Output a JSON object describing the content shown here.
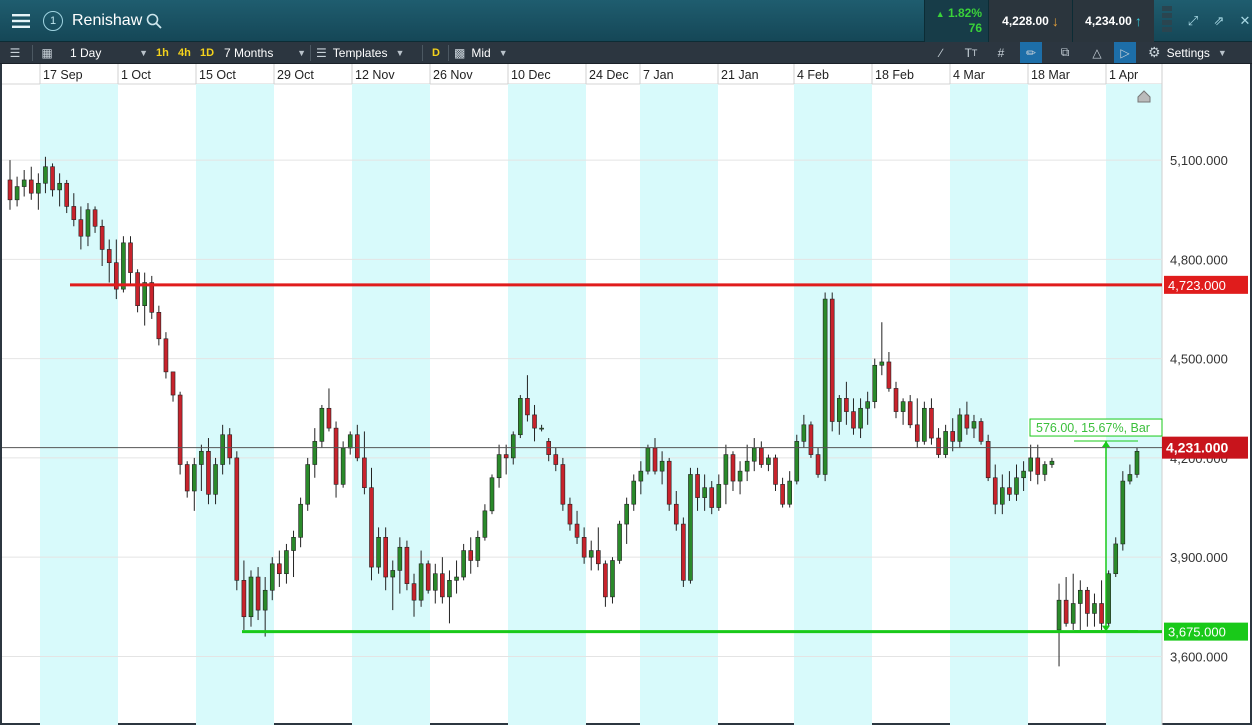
{
  "header": {
    "instrument": "Renishaw",
    "account_number": "1",
    "change_percent": "1.82%",
    "change_points": "76",
    "sell_price": "4,228.00",
    "buy_price": "4,234.00"
  },
  "toolbar": {
    "interval": "1 Day",
    "quick_intervals": [
      "1h",
      "4h",
      "1D"
    ],
    "range": "7 Months",
    "templates": "Templates",
    "d_badge": "D",
    "price_type": "Mid",
    "settings": "Settings"
  },
  "icons": {
    "menu": "hamburger-icon",
    "account": "account-number-icon",
    "search": "search-icon",
    "down_arrow": "arrow-down-icon",
    "up_arrow": "arrow-up-icon",
    "expand": "expand-icon",
    "popout": "popout-icon",
    "close": "close-icon"
  },
  "colors": {
    "up_candle": "#2a8a2a",
    "down_candle": "#c8232c",
    "resistance": "#e01c1c",
    "support": "#19c919",
    "shade": "#d8fafb",
    "price_tag": "#c8141c"
  },
  "chart_data": {
    "type": "candlestick",
    "date_labels": [
      "17 Sep",
      "1 Oct",
      "15 Oct",
      "29 Oct",
      "12 Nov",
      "26 Nov",
      "10 Dec",
      "24 Dec",
      "7 Jan",
      "21 Jan",
      "4 Feb",
      "18 Feb",
      "4 Mar",
      "18 Mar",
      "1 Apr"
    ],
    "y_ticks": [
      3600,
      3900,
      4200,
      4500,
      4800,
      5100
    ],
    "y_tick_labels": [
      "3,600.000",
      "3,900.000",
      "4,200.000",
      "4,500.000",
      "4,800.000",
      "5,100.000"
    ],
    "ylim": [
      3420,
      5330
    ],
    "resistance_label": "4,723.000",
    "resistance": 4723,
    "support_label": "3,675.000",
    "support": 3675,
    "current_label": "4,231.000",
    "current": 4231,
    "measure_label": "576.00, 15.67%, Bar",
    "measure_from": 3675,
    "measure_to": 4251,
    "candles": [
      [
        5040,
        5100,
        4950,
        4980
      ],
      [
        4980,
        5050,
        4960,
        5020
      ],
      [
        5020,
        5070,
        4990,
        5040
      ],
      [
        5040,
        5080,
        4980,
        5000
      ],
      [
        5000,
        5060,
        4950,
        5030
      ],
      [
        5030,
        5110,
        5000,
        5080
      ],
      [
        5080,
        5090,
        4990,
        5010
      ],
      [
        5010,
        5060,
        4960,
        5030
      ],
      [
        5030,
        5040,
        4940,
        4960
      ],
      [
        4960,
        5000,
        4900,
        4920
      ],
      [
        4920,
        4960,
        4830,
        4870
      ],
      [
        4870,
        4970,
        4840,
        4950
      ],
      [
        4950,
        4960,
        4880,
        4900
      ],
      [
        4900,
        4920,
        4780,
        4830
      ],
      [
        4830,
        4860,
        4730,
        4790
      ],
      [
        4790,
        4860,
        4680,
        4710
      ],
      [
        4710,
        4870,
        4700,
        4850
      ],
      [
        4850,
        4870,
        4720,
        4760
      ],
      [
        4760,
        4770,
        4640,
        4660
      ],
      [
        4660,
        4760,
        4600,
        4730
      ],
      [
        4730,
        4750,
        4620,
        4640
      ],
      [
        4640,
        4660,
        4540,
        4560
      ],
      [
        4560,
        4580,
        4440,
        4460
      ],
      [
        4460,
        4460,
        4370,
        4390
      ],
      [
        4390,
        4400,
        4150,
        4180
      ],
      [
        4180,
        4190,
        4080,
        4100
      ],
      [
        4100,
        4200,
        4040,
        4180
      ],
      [
        4180,
        4240,
        4100,
        4220
      ],
      [
        4220,
        4260,
        4060,
        4090
      ],
      [
        4090,
        4200,
        4060,
        4180
      ],
      [
        4180,
        4300,
        4150,
        4270
      ],
      [
        4270,
        4290,
        4180,
        4200
      ],
      [
        4200,
        4220,
        3800,
        3830
      ],
      [
        3830,
        3890,
        3680,
        3720
      ],
      [
        3720,
        3860,
        3690,
        3840
      ],
      [
        3840,
        3870,
        3710,
        3740
      ],
      [
        3740,
        3840,
        3660,
        3800
      ],
      [
        3800,
        3900,
        3770,
        3880
      ],
      [
        3880,
        3920,
        3810,
        3850
      ],
      [
        3850,
        3940,
        3820,
        3920
      ],
      [
        3920,
        3980,
        3840,
        3960
      ],
      [
        3960,
        4080,
        3930,
        4060
      ],
      [
        4060,
        4200,
        4040,
        4180
      ],
      [
        4180,
        4290,
        4140,
        4250
      ],
      [
        4250,
        4360,
        4230,
        4350
      ],
      [
        4350,
        4410,
        4280,
        4290
      ],
      [
        4290,
        4310,
        4080,
        4120
      ],
      [
        4120,
        4250,
        4110,
        4230
      ],
      [
        4230,
        4280,
        4210,
        4270
      ],
      [
        4270,
        4300,
        4190,
        4200
      ],
      [
        4200,
        4280,
        4090,
        4110
      ],
      [
        4110,
        4170,
        3830,
        3870
      ],
      [
        3870,
        3990,
        3850,
        3960
      ],
      [
        3960,
        3990,
        3800,
        3840
      ],
      [
        3840,
        3890,
        3740,
        3860
      ],
      [
        3860,
        3960,
        3790,
        3930
      ],
      [
        3930,
        3950,
        3800,
        3820
      ],
      [
        3820,
        3850,
        3720,
        3770
      ],
      [
        3770,
        3920,
        3750,
        3880
      ],
      [
        3880,
        3890,
        3790,
        3800
      ],
      [
        3800,
        3880,
        3760,
        3850
      ],
      [
        3850,
        3900,
        3760,
        3780
      ],
      [
        3780,
        3860,
        3700,
        3830
      ],
      [
        3830,
        3890,
        3790,
        3840
      ],
      [
        3840,
        3940,
        3830,
        3920
      ],
      [
        3920,
        3960,
        3850,
        3890
      ],
      [
        3890,
        3980,
        3870,
        3960
      ],
      [
        3960,
        4060,
        3950,
        4040
      ],
      [
        4040,
        4150,
        4030,
        4140
      ],
      [
        4140,
        4240,
        4110,
        4210
      ],
      [
        4210,
        4240,
        4150,
        4200
      ],
      [
        4200,
        4280,
        4180,
        4270
      ],
      [
        4270,
        4390,
        4260,
        4380
      ],
      [
        4380,
        4450,
        4310,
        4330
      ],
      [
        4330,
        4360,
        4250,
        4290
      ],
      [
        4290,
        4300,
        4280,
        4290
      ],
      [
        4250,
        4260,
        4190,
        4210
      ],
      [
        4210,
        4230,
        4160,
        4180
      ],
      [
        4180,
        4200,
        4040,
        4060
      ],
      [
        4060,
        4080,
        3980,
        4000
      ],
      [
        4000,
        4040,
        3940,
        3960
      ],
      [
        3960,
        3990,
        3880,
        3900
      ],
      [
        3900,
        3950,
        3860,
        3920
      ],
      [
        3920,
        3990,
        3860,
        3880
      ],
      [
        3880,
        3890,
        3750,
        3780
      ],
      [
        3780,
        3900,
        3760,
        3890
      ],
      [
        3890,
        4010,
        3880,
        4000
      ],
      [
        4000,
        4080,
        3940,
        4060
      ],
      [
        4060,
        4150,
        4040,
        4130
      ],
      [
        4130,
        4190,
        4090,
        4160
      ],
      [
        4160,
        4240,
        4150,
        4230
      ],
      [
        4230,
        4260,
        4150,
        4160
      ],
      [
        4160,
        4220,
        4120,
        4190
      ],
      [
        4190,
        4200,
        4040,
        4060
      ],
      [
        4060,
        4100,
        3980,
        4000
      ],
      [
        4000,
        4020,
        3810,
        3830
      ],
      [
        3830,
        4170,
        3820,
        4150
      ],
      [
        4150,
        4170,
        4040,
        4080
      ],
      [
        4080,
        4150,
        4040,
        4110
      ],
      [
        4110,
        4130,
        4030,
        4050
      ],
      [
        4050,
        4150,
        4040,
        4120
      ],
      [
        4120,
        4240,
        4060,
        4210
      ],
      [
        4210,
        4220,
        4100,
        4130
      ],
      [
        4130,
        4190,
        4090,
        4160
      ],
      [
        4160,
        4240,
        4130,
        4190
      ],
      [
        4190,
        4260,
        4160,
        4230
      ],
      [
        4230,
        4250,
        4170,
        4180
      ],
      [
        4180,
        4210,
        4160,
        4200
      ],
      [
        4200,
        4210,
        4100,
        4120
      ],
      [
        4120,
        4140,
        4050,
        4060
      ],
      [
        4060,
        4160,
        4050,
        4130
      ],
      [
        4130,
        4270,
        4120,
        4250
      ],
      [
        4250,
        4330,
        4230,
        4300
      ],
      [
        4300,
        4310,
        4200,
        4210
      ],
      [
        4210,
        4230,
        4140,
        4150
      ],
      [
        4150,
        4700,
        4130,
        4680
      ],
      [
        4680,
        4700,
        4280,
        4310
      ],
      [
        4310,
        4390,
        4270,
        4380
      ],
      [
        4380,
        4430,
        4300,
        4340
      ],
      [
        4340,
        4380,
        4270,
        4290
      ],
      [
        4290,
        4380,
        4260,
        4350
      ],
      [
        4350,
        4400,
        4300,
        4370
      ],
      [
        4370,
        4500,
        4350,
        4480
      ],
      [
        4480,
        4610,
        4450,
        4490
      ],
      [
        4490,
        4520,
        4400,
        4410
      ],
      [
        4410,
        4430,
        4320,
        4340
      ],
      [
        4340,
        4380,
        4300,
        4370
      ],
      [
        4370,
        4390,
        4290,
        4300
      ],
      [
        4300,
        4380,
        4230,
        4250
      ],
      [
        4250,
        4370,
        4240,
        4350
      ],
      [
        4350,
        4380,
        4240,
        4260
      ],
      [
        4260,
        4290,
        4200,
        4210
      ],
      [
        4210,
        4300,
        4200,
        4280
      ],
      [
        4280,
        4320,
        4220,
        4250
      ],
      [
        4250,
        4350,
        4230,
        4330
      ],
      [
        4330,
        4370,
        4270,
        4290
      ],
      [
        4290,
        4330,
        4260,
        4310
      ],
      [
        4310,
        4320,
        4240,
        4250
      ],
      [
        4250,
        4270,
        4130,
        4140
      ],
      [
        4140,
        4180,
        4030,
        4060
      ],
      [
        4060,
        4150,
        4030,
        4110
      ],
      [
        4110,
        4160,
        4070,
        4090
      ],
      [
        4090,
        4180,
        4070,
        4140
      ],
      [
        4140,
        4190,
        4100,
        4160
      ],
      [
        4160,
        4240,
        4130,
        4200
      ],
      [
        4200,
        4240,
        4120,
        4150
      ],
      [
        4150,
        4190,
        4130,
        4180
      ],
      [
        4180,
        4200,
        4170,
        4190
      ],
      [
        3680,
        3820,
        3570,
        3770
      ],
      [
        3770,
        3840,
        3690,
        3700
      ],
      [
        3700,
        3850,
        3680,
        3760
      ],
      [
        3760,
        3830,
        3680,
        3800
      ],
      [
        3800,
        3810,
        3690,
        3730
      ],
      [
        3730,
        3790,
        3690,
        3760
      ],
      [
        3760,
        3830,
        3680,
        3700
      ],
      [
        3700,
        3860,
        3690,
        3850
      ],
      [
        3850,
        3960,
        3840,
        3940
      ],
      [
        3940,
        4160,
        3920,
        4130
      ],
      [
        4130,
        4180,
        4120,
        4150
      ],
      [
        4150,
        4230,
        4140,
        4220
      ]
    ]
  }
}
